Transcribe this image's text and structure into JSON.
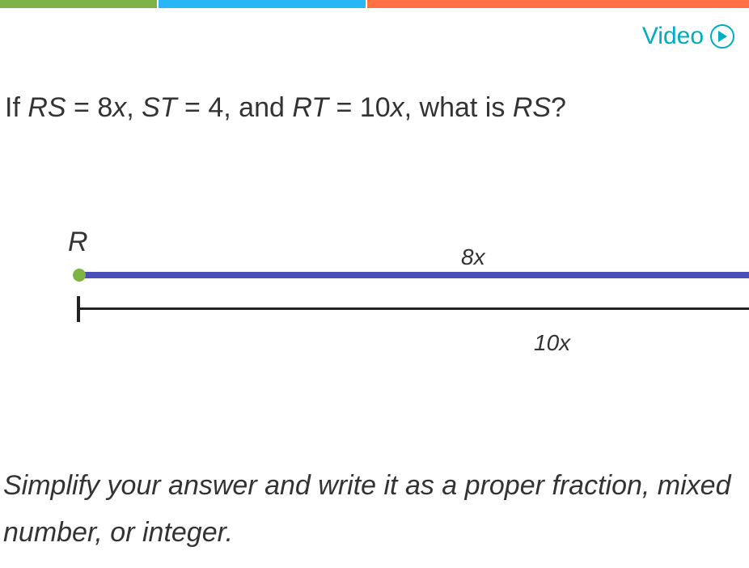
{
  "header": {
    "video_label": "Video"
  },
  "question": {
    "prefix": "If ",
    "rs": "RS",
    "eq1": " = 8",
    "x1": "x",
    "comma1": ", ",
    "st": "ST",
    "eq2": " = 4, and ",
    "rt": "RT",
    "eq3": " = 10",
    "x2": "x",
    "comma2": ", what is ",
    "rs2": "RS",
    "qmark": "?"
  },
  "diagram": {
    "R": "R",
    "label_8x": "8x",
    "label_10x": "10x"
  },
  "instruction": "Simplify your answer and write it as a proper fraction, mixed number, or integer."
}
